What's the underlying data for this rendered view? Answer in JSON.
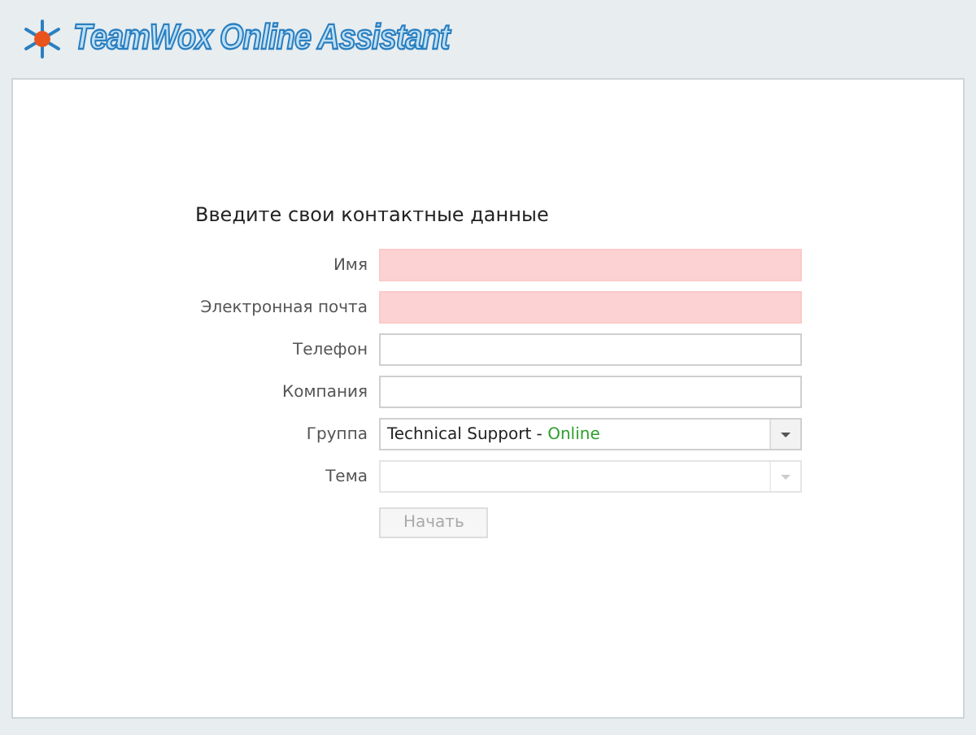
{
  "header": {
    "logo": "TeamWox Online Assistant"
  },
  "form": {
    "title": "Введите свои контактные данные",
    "fields": [
      {
        "kind": "text",
        "label": "Имя",
        "invalid": true
      },
      {
        "kind": "text",
        "label": "Электронная почта",
        "invalid": true
      },
      {
        "kind": "text",
        "label": "Телефон",
        "invalid": false
      },
      {
        "kind": "text",
        "label": "Компания",
        "invalid": false
      },
      {
        "kind": "select",
        "label": "Группа",
        "value": "Technical Support - ",
        "status": "Online",
        "disabled": false
      },
      {
        "kind": "select",
        "label": "Тема",
        "disabled": true
      }
    ],
    "submit": {
      "label": "Начать",
      "disabled": true
    }
  }
}
